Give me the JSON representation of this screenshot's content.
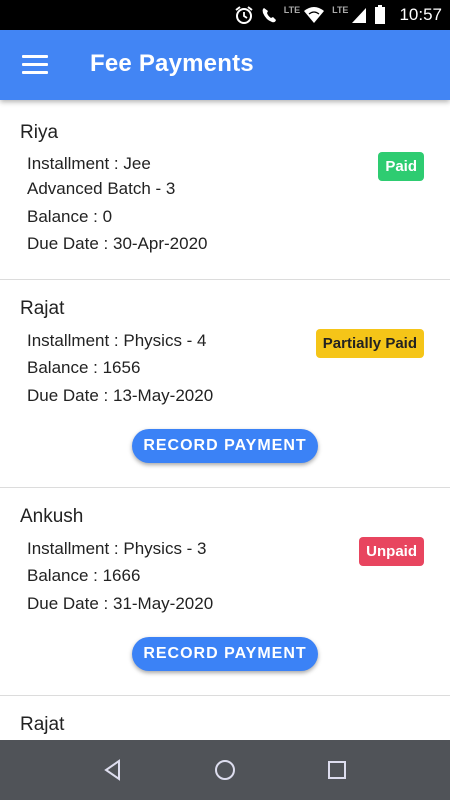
{
  "status_bar": {
    "time": "10:57",
    "network_label": "LTE",
    "icons": [
      "alarm-icon",
      "call-lte-icon",
      "wifi-icon",
      "signal-icon",
      "battery-icon"
    ]
  },
  "app_bar": {
    "title": "Fee Payments",
    "menu_icon": "hamburger-menu-icon"
  },
  "colors": {
    "primary": "#4285f4",
    "button": "#3b82f6",
    "paid": "#2ecc71",
    "partially_paid": "#f5c518",
    "unpaid": "#e8455f",
    "nav_bar": "#505358"
  },
  "payments": [
    {
      "name": "Riya",
      "installment": "Installment : Jee",
      "installment_cont": "Advanced Batch - 3",
      "balance": "Balance : 0",
      "due_date": "Due Date : 30-Apr-2020",
      "status": "Paid"
    },
    {
      "name": "Rajat",
      "installment": "Installment : Physics - 4",
      "balance": "Balance : 1656",
      "due_date": "Due Date : 13-May-2020",
      "status": "Partially Paid",
      "action": "RECORD PAYMENT"
    },
    {
      "name": "Ankush",
      "installment": "Installment : Physics - 3",
      "balance": "Balance : 1666",
      "due_date": "Due Date : 31-May-2020",
      "status": "Unpaid",
      "action": "RECORD PAYMENT"
    },
    {
      "name": "Rajat"
    }
  ],
  "nav_bar": {
    "icons": [
      "back-icon",
      "home-icon",
      "recents-icon"
    ]
  }
}
